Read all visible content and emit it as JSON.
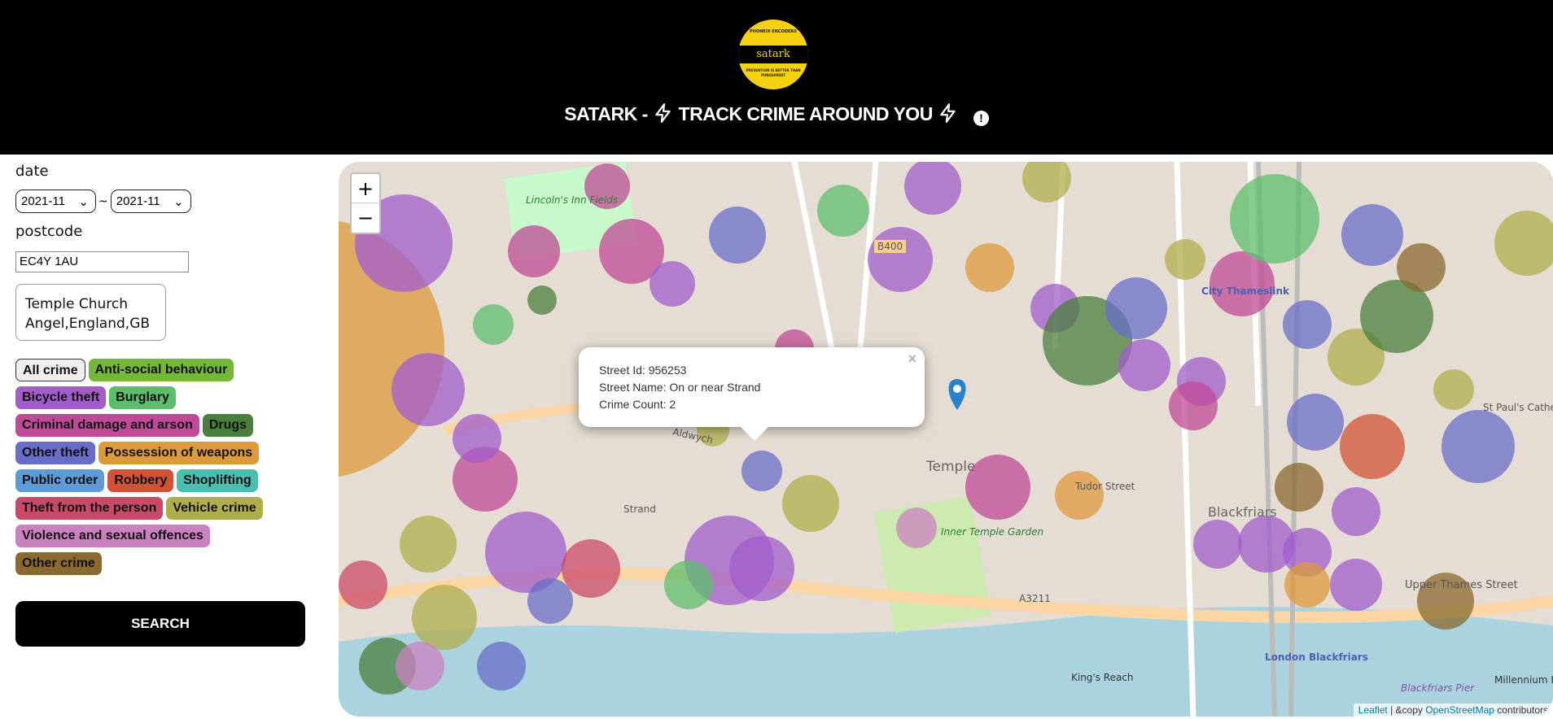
{
  "header": {
    "logo": {
      "top_text": "PHONEIX ENCODERS",
      "band_text": "satark",
      "bottom_text": "PREVENTION IS BETTER THAN PUNISHMENT"
    },
    "title_left": "SATARK - ",
    "title_mid": " TRACK CRIME AROUND YOU ",
    "info_icon": "!"
  },
  "sidebar": {
    "date_label": "date",
    "date_from": "2021-11",
    "date_sep": "~",
    "date_to": "2021-11",
    "postcode_label": "postcode",
    "postcode_value": "EC4Y 1AU",
    "location_line1": "Temple Church",
    "location_line2": "Angel,England,GB",
    "categories": [
      {
        "label": "All crime",
        "color": "#eeeeee"
      },
      {
        "label": "Anti-social behaviour",
        "color": "#75b738"
      },
      {
        "label": "Bicycle theft",
        "color": "#a25ccc"
      },
      {
        "label": "Burglary",
        "color": "#5cbd6d"
      },
      {
        "label": "Criminal damage and arson",
        "color": "#bf4a97"
      },
      {
        "label": "Drugs",
        "color": "#4a7f3e"
      },
      {
        "label": "Other theft",
        "color": "#6a6dc8"
      },
      {
        "label": "Possession of weapons",
        "color": "#dc9a3c"
      },
      {
        "label": "Public order",
        "color": "#5d9ad6"
      },
      {
        "label": "Robbery",
        "color": "#cf5336"
      },
      {
        "label": "Shoplifting",
        "color": "#4dbdaf"
      },
      {
        "label": "Theft from the person",
        "color": "#c9496b"
      },
      {
        "label": "Vehicle crime",
        "color": "#b0ae4b"
      },
      {
        "label": "Violence and sexual offences",
        "color": "#c981bf"
      },
      {
        "label": "Other crime",
        "color": "#8a6a2e"
      }
    ],
    "search_label": "SEARCH"
  },
  "map": {
    "zoom_in": "+",
    "zoom_out": "−",
    "popup": {
      "street_id": "Street Id: 956253",
      "street_name": "Street Name: On or near Strand",
      "crime_count": "Crime Count: 2",
      "close": "×"
    },
    "attribution": {
      "leaflet": "Leaflet",
      "sep": " | &copy ",
      "osm": "OpenStreetMap",
      "tail": " contributors"
    },
    "labels": [
      "Lincoln's Inn Fields",
      "Temple",
      "Blackfriars",
      "Inner Temple Garden",
      "Tudor Street",
      "Upper Thames Street",
      "London Blackfriars",
      "Aldwych",
      "Strand",
      "A3211",
      "B400",
      "St Paul's Cathedral",
      "City Thameslink",
      "Millennium Bridge",
      "Blackfriars Pier",
      "King's Reach"
    ]
  }
}
